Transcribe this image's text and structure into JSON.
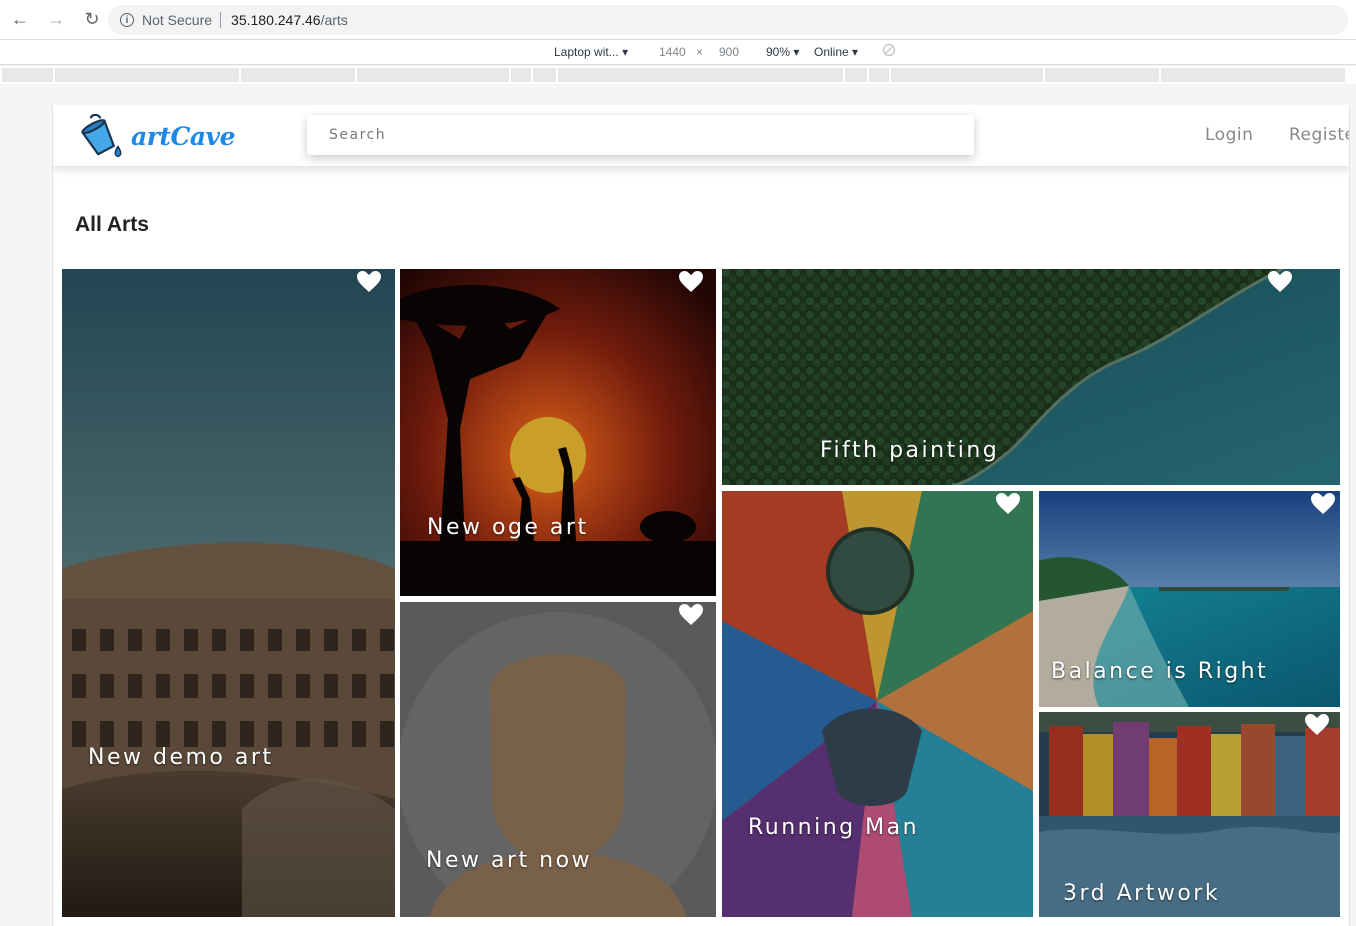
{
  "browser": {
    "not_secure": "Not Secure",
    "url_host": "35.180.247.46",
    "url_path": "/arts"
  },
  "devtools": {
    "device": "Laptop wit...",
    "width": "1440",
    "times": "×",
    "height": "900",
    "zoom": "90%",
    "network": "Online"
  },
  "header": {
    "logo_text": "artCave",
    "search_placeholder": "Search",
    "login": "Login",
    "register": "Registe"
  },
  "page": {
    "title": "All Arts"
  },
  "arts": [
    {
      "title": "New demo art"
    },
    {
      "title": "New oge art"
    },
    {
      "title": "New art now"
    },
    {
      "title": "Fifth painting"
    },
    {
      "title": "Running Man"
    },
    {
      "title": "Balance is Right"
    },
    {
      "title": "3rd Artwork"
    }
  ],
  "colors": {
    "brand": "#1e88e5",
    "heart": "#ffffff"
  }
}
